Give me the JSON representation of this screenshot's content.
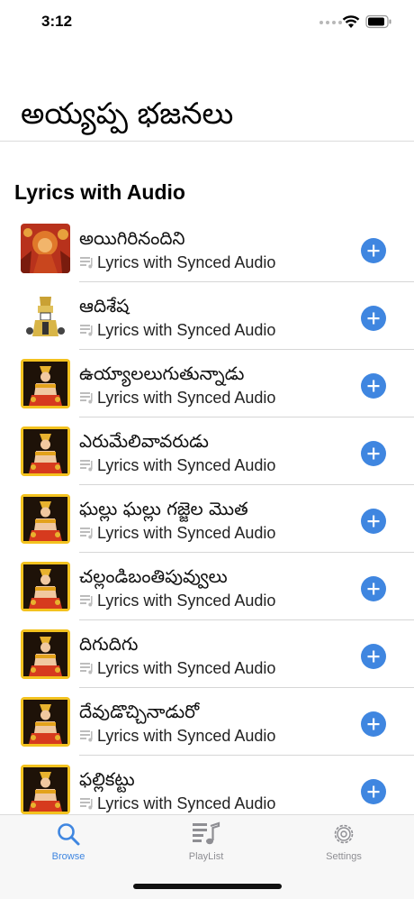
{
  "status_bar": {
    "time": "3:12"
  },
  "page_title": "అయ్యప్ప భజనలు",
  "section_header": "Lyrics with Audio",
  "songs": [
    {
      "title": "అయిగిరినందిని",
      "subtitle": "Lyrics with Synced Audio",
      "thumbnail": "durga-image"
    },
    {
      "title": "ఆదిశేష",
      "subtitle": "Lyrics with Synced Audio",
      "thumbnail": "venkateswara-image"
    },
    {
      "title": "ఉయ్యాలలుగుతున్నాడు",
      "subtitle": "Lyrics with Synced Audio",
      "thumbnail": "ayyappa-image"
    },
    {
      "title": "ఎరుమేలివావరుడు",
      "subtitle": "Lyrics with Synced Audio",
      "thumbnail": "ayyappa-image"
    },
    {
      "title": "ఘల్లు ఘల్లు గజ్జెల మొత",
      "subtitle": "Lyrics with Synced Audio",
      "thumbnail": "ayyappa-image"
    },
    {
      "title": "చల్లండిబంతిపువ్వులు",
      "subtitle": "Lyrics with Synced Audio",
      "thumbnail": "ayyappa-image"
    },
    {
      "title": "దిగుదిగు",
      "subtitle": "Lyrics with Synced Audio",
      "thumbnail": "ayyappa-image"
    },
    {
      "title": "దేవుడొచ్చినాడురో",
      "subtitle": "Lyrics with Synced Audio",
      "thumbnail": "ayyappa-image"
    },
    {
      "title": "ఫల్లికట్టు",
      "subtitle": "Lyrics with Synced Audio",
      "thumbnail": "ayyappa-image"
    }
  ],
  "tabs": [
    {
      "label": "Browse",
      "icon": "search-icon",
      "active": true
    },
    {
      "label": "PlayList",
      "icon": "playlist-icon",
      "active": false
    },
    {
      "label": "Settings",
      "icon": "gear-icon",
      "active": false
    }
  ],
  "colors": {
    "accent": "#3f86e0",
    "inactive_tab": "#8e8e93"
  }
}
